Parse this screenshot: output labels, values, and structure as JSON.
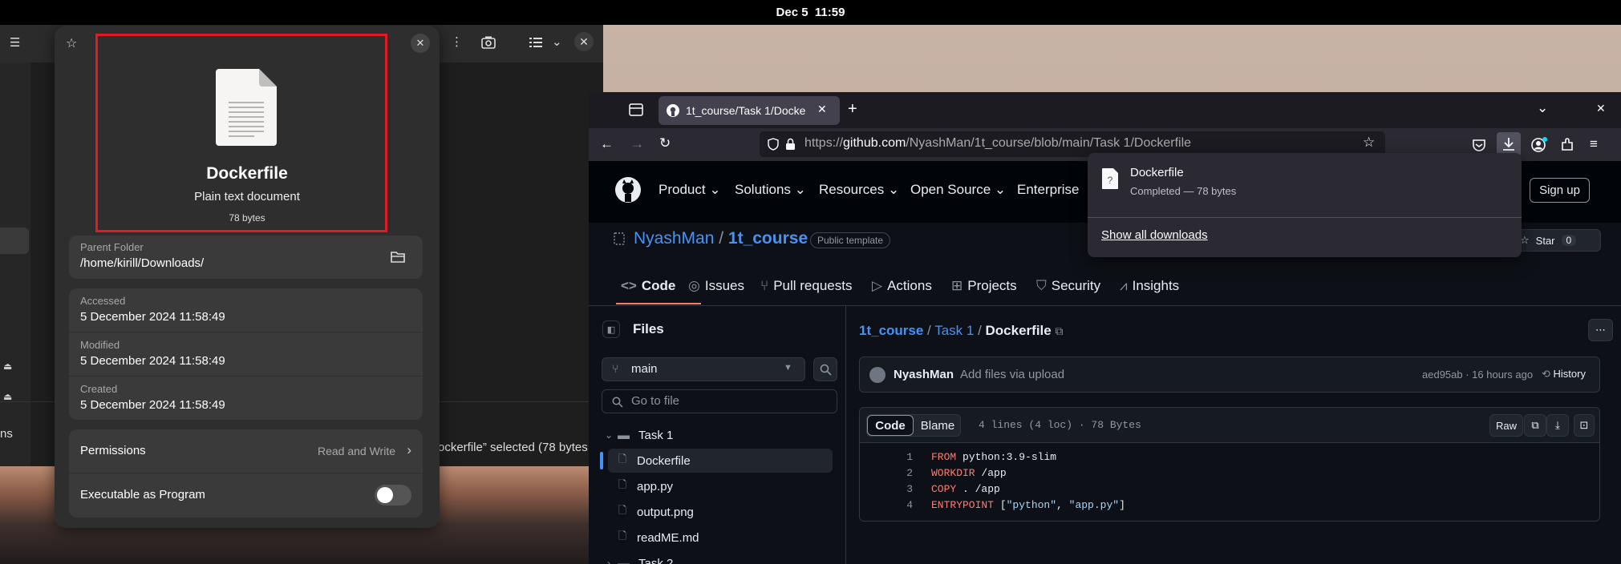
{
  "topbar": {
    "datetime": "Dec 5  11:59"
  },
  "file_manager": {
    "status_text": "ockerfile” selected  (78 bytes",
    "sidebar_label": "ns"
  },
  "properties": {
    "file_name": "Dockerfile",
    "file_type": "Plain text document",
    "file_size": "78 bytes",
    "parent_folder_label": "Parent Folder",
    "parent_folder_value": "/home/kirill/Downloads/",
    "accessed_label": "Accessed",
    "accessed_value": "5 December 2024 11:58:49",
    "modified_label": "Modified",
    "modified_value": "5 December 2024 11:58:49",
    "created_label": "Created",
    "created_value": "5 December 2024 11:58:49",
    "permissions_label": "Permissions",
    "permissions_value": "Read and Write",
    "executable_label": "Executable as Program",
    "executable_on": false
  },
  "browser": {
    "tab_title": "1t_course/Task 1/Docke",
    "url_prefix": "https://",
    "url_domain": "github.com",
    "url_path": "/NyashMan/1t_course/blob/main/Task 1/Dockerfile"
  },
  "downloads_panel": {
    "file_name": "Dockerfile",
    "status": "Completed — 78 bytes",
    "show_all": "Show all downloads"
  },
  "github": {
    "menu": [
      "Product",
      "Solutions",
      "Resources",
      "Open Source",
      "Enterprise"
    ],
    "sign_up": "Sign up",
    "owner": "NyashMan",
    "repo": "1t_course",
    "visibility": "Public template",
    "star_label": "Star",
    "star_count": "0",
    "tabs": [
      "Code",
      "Issues",
      "Pull requests",
      "Actions",
      "Projects",
      "Security",
      "Insights"
    ],
    "files_title": "Files",
    "branch": "main",
    "goto_placeholder": "Go to file",
    "tree": {
      "folder": "Task 1",
      "items": [
        "Dockerfile",
        "app.py",
        "output.png",
        "readME.md"
      ],
      "next_folder": "Task 2"
    },
    "breadcrumb": {
      "repo": "1t_course",
      "folder": "Task 1",
      "file": "Dockerfile"
    },
    "commit": {
      "author": "NyashMan",
      "message": "Add files via upload",
      "sha_time": "aed95ab · 16 hours ago",
      "history": "History"
    },
    "view": {
      "code": "Code",
      "blame": "Blame",
      "info": "4 lines (4 loc) · 78 Bytes",
      "raw": "Raw"
    },
    "code_lines": [
      {
        "n": "1",
        "kw": "FROM",
        "rest": " python:3.9-slim"
      },
      {
        "n": "2",
        "kw": "WORKDIR",
        "rest": " /app"
      },
      {
        "n": "3",
        "kw": "COPY",
        "rest": " . /app"
      },
      {
        "n": "4",
        "kw": "ENTRYPOINT",
        "rest": " [",
        "s1": "\"python\"",
        "mid": ", ",
        "s2": "\"app.py\"",
        "end": "]"
      }
    ]
  },
  "colors": {
    "accent_red": "#e01b24",
    "gh_link": "#4493f8",
    "gh_tab_underline": "#f78166"
  }
}
